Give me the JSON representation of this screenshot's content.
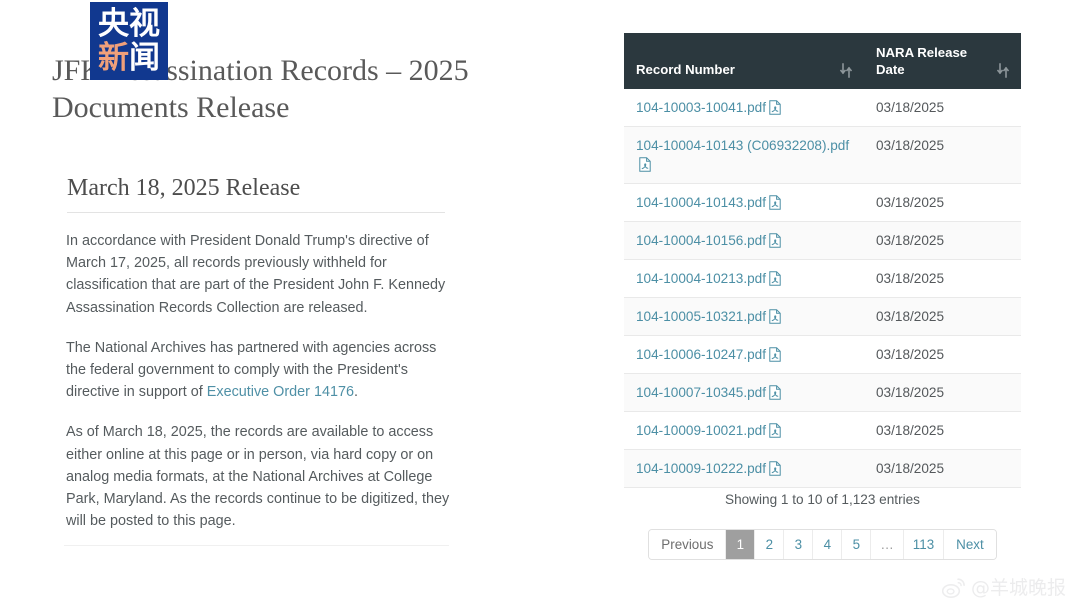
{
  "logo": {
    "name": "cctv-news-logo",
    "line1": [
      "央",
      "视"
    ],
    "line2": [
      "新",
      "闻"
    ],
    "background_color": "#11388f",
    "accent_color": "#f0a07a"
  },
  "article": {
    "title": "JFK Assassination Records – 2025 Documents Release",
    "section_heading": "March 18, 2025 Release",
    "paragraphs": [
      "In accordance with President Donald Trump's directive of March 17, 2025, all records previously withheld for classification that are part of the President John F. Kennedy Assassination Records Collection are released.",
      "The National Archives has partnered with agencies across the federal government to comply with the President's directive in support of ",
      "As of March 18, 2025, the records are available to access either online at this page or in person, via hard copy or on analog media formats, at the National Archives at College Park, Maryland. As the records continue to be digitized, they will be posted to this page."
    ],
    "link_text": "Executive Order 14176",
    "link_color": "#4f90a6",
    "paragraph2_suffix": "."
  },
  "table": {
    "columns": [
      {
        "label": "Record Number",
        "sort_icon": "sort-updown-icon"
      },
      {
        "label": "NARA Release Date",
        "sort_icon": "sort-updown-icon"
      }
    ],
    "header_background": "#2b383e",
    "link_color": "#4c8fa5",
    "rows": [
      {
        "record": "104-10003-10041.pdf",
        "date": "03/18/2025"
      },
      {
        "record": "104-10004-10143 (C06932208).pdf",
        "date": "03/18/2025"
      },
      {
        "record": "104-10004-10143.pdf",
        "date": "03/18/2025"
      },
      {
        "record": "104-10004-10156.pdf",
        "date": "03/18/2025"
      },
      {
        "record": "104-10004-10213.pdf",
        "date": "03/18/2025"
      },
      {
        "record": "104-10005-10321.pdf",
        "date": "03/18/2025"
      },
      {
        "record": "104-10006-10247.pdf",
        "date": "03/18/2025"
      },
      {
        "record": "104-10007-10345.pdf",
        "date": "03/18/2025"
      },
      {
        "record": "104-10009-10021.pdf",
        "date": "03/18/2025"
      },
      {
        "record": "104-10009-10222.pdf",
        "date": "03/18/2025"
      }
    ]
  },
  "footer": {
    "showing_entries": "Showing 1 to 10 of 1,123 entries",
    "pagination": {
      "previous_label": "Previous",
      "next_label": "Next",
      "pages": [
        "1",
        "2",
        "3",
        "4",
        "5",
        "…",
        "113"
      ],
      "active_page": "1",
      "active_background": "#9f9f9f"
    }
  },
  "watermark": {
    "icon": "weibo-icon",
    "text": "@羊城晚报"
  }
}
